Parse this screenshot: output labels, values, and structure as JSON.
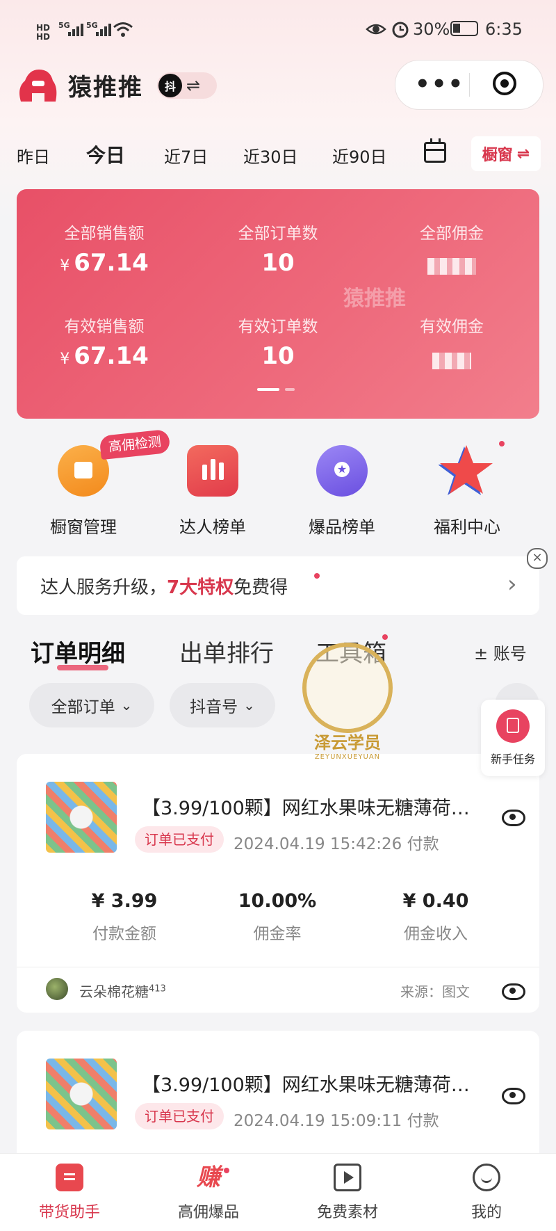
{
  "status_bar": {
    "hd1": "HD",
    "hd2": "HD",
    "net1": "5G",
    "net2": "5G",
    "battery": "30%",
    "time": "6:35"
  },
  "header": {
    "brand": "猿推推",
    "platform_badge": "抖",
    "swap_symbol": "⇌",
    "menu_dots": "•••"
  },
  "date_tabs": [
    "昨日",
    "今日",
    "近7日",
    "近30日",
    "近90日"
  ],
  "active_date_tab": "今日",
  "window_button": {
    "label": "橱窗",
    "symbol": "⇌"
  },
  "summary_card": {
    "watermark": "猿推推",
    "stats": [
      {
        "label": "全部销售额",
        "currency": "¥",
        "value": "67.14"
      },
      {
        "label": "全部订单数",
        "currency": "",
        "value": "10"
      },
      {
        "label": "全部佣金",
        "currency": "",
        "value": ""
      },
      {
        "label": "有效销售额",
        "currency": "¥",
        "value": "67.14"
      },
      {
        "label": "有效订单数",
        "currency": "",
        "value": "10"
      },
      {
        "label": "有效佣金",
        "currency": "",
        "value": ""
      }
    ],
    "page_indicator": {
      "current": 1,
      "total": 2
    }
  },
  "shortcuts": [
    {
      "label": "橱窗管理",
      "icon": "bag-icon",
      "color": "#f7941d"
    },
    {
      "label": "达人榜单",
      "icon": "bar-chart-icon",
      "color": "#e8484f"
    },
    {
      "label": "爆品榜单",
      "icon": "medal-icon",
      "color": "#7a63e8"
    },
    {
      "label": "福利中心",
      "icon": "star-icon",
      "color": "#e8484f"
    }
  ],
  "shortcut_tag": "高佣检测",
  "banner": {
    "prefix": "达人服务升级，",
    "highlight": "7大特权",
    "suffix": "免费得",
    "close": "×",
    "arrow": "›"
  },
  "section_tabs": [
    "订单明细",
    "出单排行",
    "工具箱"
  ],
  "account_button": "± 账号",
  "filters": [
    {
      "label": "全部订单",
      "chevron": "⌄"
    },
    {
      "label": "抖音号",
      "chevron": "⌄"
    }
  ],
  "stamp": {
    "title": "泽云学员",
    "subtitle": "ZEYUNXUEYUAN"
  },
  "task_float": {
    "label": "新手任务"
  },
  "orders": [
    {
      "title": "【3.99/100颗】网红水果味无糖薄荷…",
      "status": "订单已支付",
      "time": "2024.04.19 15:42:26  付款",
      "metrics": [
        {
          "value": "¥ 3.99",
          "label": "付款金额"
        },
        {
          "value": "10.00%",
          "label": "佣金率"
        },
        {
          "value": "¥ 0.40",
          "label": "佣金收入"
        }
      ],
      "user": "云朵棉花糖",
      "user_sup": "413",
      "source": "来源：图文"
    },
    {
      "title": "【3.99/100颗】网红水果味无糖薄荷…",
      "status": "订单已支付",
      "time": "2024.04.19 15:09:11  付款"
    }
  ],
  "bottom_nav": [
    {
      "label": "带货助手",
      "icon": "assistant-icon",
      "active": true
    },
    {
      "label": "高佣爆品",
      "icon": "earn-icon",
      "glyph": "赚",
      "active": false
    },
    {
      "label": "免费素材",
      "icon": "play-icon",
      "active": false
    },
    {
      "label": "我的",
      "icon": "smile-icon",
      "active": false
    }
  ],
  "colors": {
    "accent": "#d8374d",
    "card": "#e85067"
  }
}
